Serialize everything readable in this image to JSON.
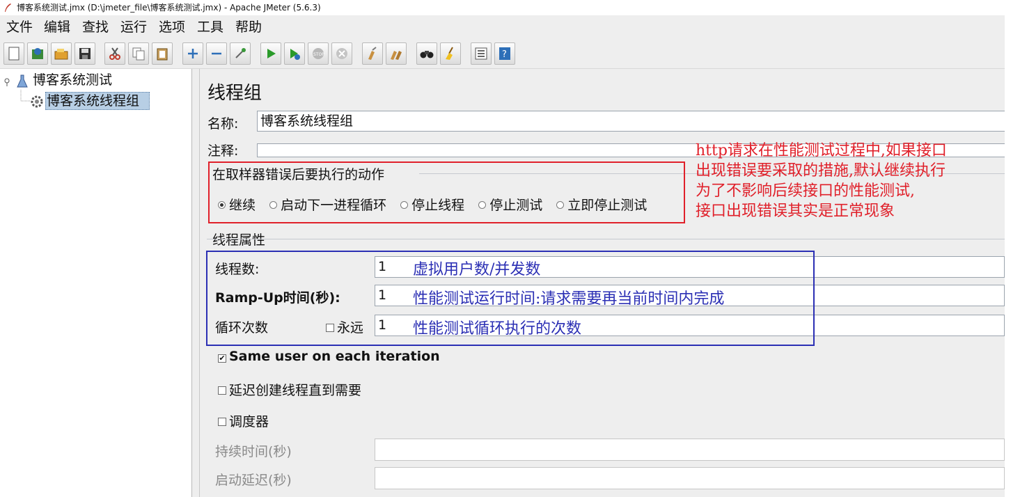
{
  "window": {
    "title": "博客系统测试.jmx (D:\\jmeter_file\\博客系统测试.jmx) - Apache JMeter (5.6.3)"
  },
  "menu": [
    "文件",
    "编辑",
    "查找",
    "运行",
    "选项",
    "工具",
    "帮助"
  ],
  "toolbar": {
    "buttons": [
      {
        "icon": "new-icon"
      },
      {
        "icon": "templates-icon"
      },
      {
        "icon": "open-icon"
      },
      {
        "icon": "save-icon"
      },
      {
        "icon": "cut-icon"
      },
      {
        "icon": "copy-icon"
      },
      {
        "icon": "paste-icon"
      },
      {
        "icon": "expand-icon"
      },
      {
        "icon": "collapse-icon"
      },
      {
        "icon": "toggle-icon"
      },
      {
        "icon": "start-icon"
      },
      {
        "icon": "start-no-pause-icon"
      },
      {
        "icon": "stop-icon"
      },
      {
        "icon": "shutdown-icon"
      },
      {
        "icon": "clear-icon"
      },
      {
        "icon": "clear-all-icon"
      },
      {
        "icon": "search-icon"
      },
      {
        "icon": "reset-search-icon"
      },
      {
        "icon": "function-helper-icon"
      },
      {
        "icon": "help-icon"
      }
    ]
  },
  "tree": {
    "root": "博客系统测试",
    "child": "博客系统线程组"
  },
  "panel": {
    "title": "线程组",
    "name_label": "名称:",
    "name_value": "博客系统线程组",
    "comment_label": "注释:",
    "comment_value": "",
    "error_action": {
      "title": "在取样器错误后要执行的动作",
      "options": [
        "继续",
        "启动下一进程循环",
        "停止线程",
        "停止测试",
        "立即停止测试"
      ],
      "selected": "继续"
    },
    "thread_props": {
      "title": "线程属性",
      "threads_label": "线程数:",
      "threads_value": "1",
      "rampup_label": "Ramp-Up时间(秒):",
      "rampup_value": "1",
      "loop_label": "循环次数",
      "forever_label": "永远",
      "forever_checked": false,
      "loop_value": "1"
    },
    "same_user": {
      "label": "Same user on each iteration",
      "checked": true
    },
    "delay_create": {
      "label": "延迟创建线程直到需要",
      "checked": false
    },
    "scheduler": {
      "label": "调度器",
      "checked": false
    },
    "duration_label": "持续时间(秒)",
    "startup_delay_label": "启动延迟(秒)"
  },
  "annotations": {
    "red_lines": [
      "http请求在性能测试过程中,如果接口",
      "出现错误要采取的措施,默认继续执行",
      "为了不影响后续接口的性能测试,",
      "接口出现错误其实是正常现象"
    ],
    "blue_threads": "虚拟用户数/并发数",
    "blue_rampup": "性能测试运行时间:请求需要再当前时间内完成",
    "blue_loop": "性能测试循环执行的次数",
    "colors": {
      "red": "#e0202a",
      "blue": "#2b2fb4"
    }
  }
}
